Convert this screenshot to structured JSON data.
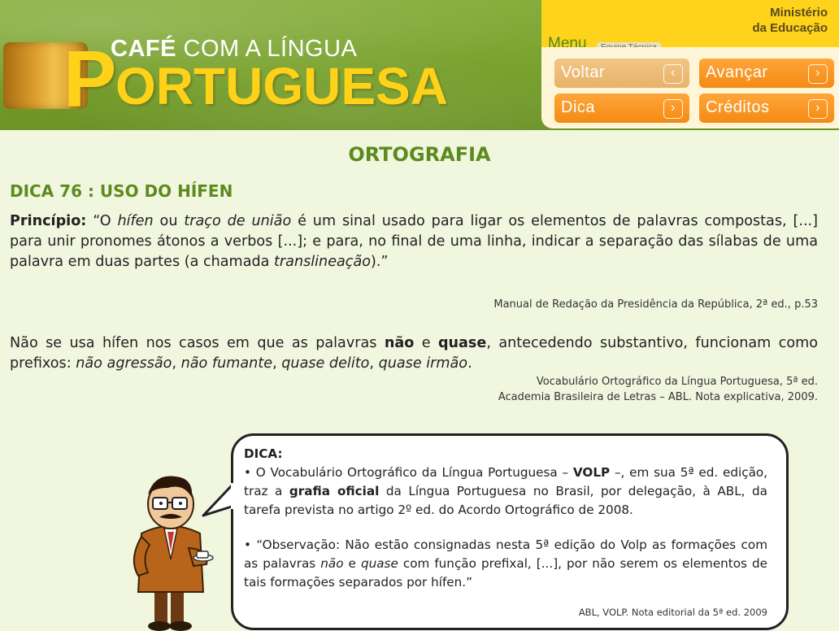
{
  "header": {
    "logo_top_bold": "CAFÉ",
    "logo_top_rest": " COM A LÍNGUA",
    "logo_big_initial": "P",
    "logo_big_rest": "ORTUGUESA",
    "ministerio_line1": "Ministério",
    "ministerio_line2": "da Educação"
  },
  "menu": {
    "tab_menu": "Menu",
    "tab_equipe": "Equipe Técnica",
    "buttons": [
      {
        "label": "Voltar",
        "arrow": "‹"
      },
      {
        "label": "Avançar",
        "arrow": "›"
      },
      {
        "label": "Dica",
        "arrow": "›"
      },
      {
        "label": "Créditos",
        "arrow": "›"
      }
    ]
  },
  "content": {
    "title": "ORTOGRAFIA",
    "subtitle": "DICA 76 : USO DO HÍFEN",
    "principio_label": "Princípio:",
    "principio_parts": [
      " “O ",
      "hífen",
      " ou ",
      "traço de união",
      " é um sinal usado para ligar os elementos de palavras compostas, [...] para unir pronomes átonos a verbos [...]; e para, no final de uma linha, indicar a separação das sílabas de uma palavra em duas partes (a chamada ",
      "translineação",
      ").”"
    ],
    "source1": "Manual de Redação da Presidência da República, 2ª ed., p.53",
    "para2_parts": [
      "Não se usa hífen nos casos em que as palavras ",
      "não",
      " e ",
      "quase",
      ", antecedendo substantivo, funcionam como prefixos: ",
      "não agressão",
      ", ",
      "não fumante",
      ", ",
      "quase delito",
      ", ",
      "quase irmão",
      "."
    ],
    "source2_line1": "Vocabulário Ortográfico da Língua Portuguesa, 5ª ed.",
    "source2_line2": "Academia Brasileira de Letras – ABL. Nota explicativa, 2009."
  },
  "bubble": {
    "title": "DICA:",
    "item1_parts": [
      "•  O Vocabulário Ortográfico da Língua Portuguesa  – ",
      "VOLP",
      " –, em sua 5ª ed. edição, traz a ",
      "grafia oficial",
      " da Língua Portuguesa no Brasil, por delegação, à ABL, da tarefa prevista no artigo 2º ed. do Acordo Ortográfico de 2008."
    ],
    "item2_parts": [
      "•  “Observação: Não estão consignadas nesta 5ª edição do Volp as formações com as palavras ",
      "não",
      " e ",
      "quase",
      " com função prefixal, [...], por não serem os elementos de tais formações separados por hífen.”"
    ],
    "source": "ABL, VOLP. Nota editorial da 5ª ed. 2009"
  }
}
